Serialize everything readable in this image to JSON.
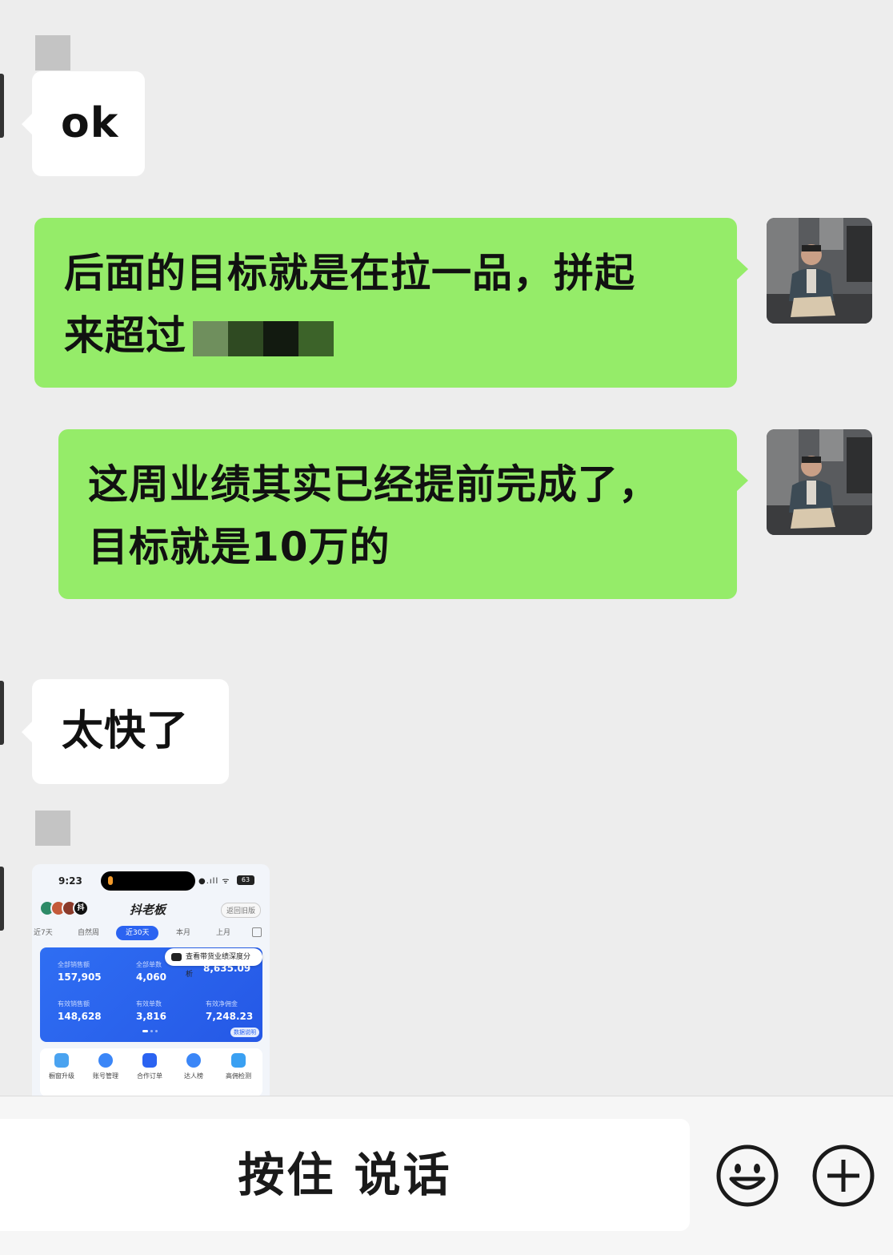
{
  "messages": {
    "m1": {
      "text": "ok"
    },
    "m2": {
      "text_line1": "后面的目标就是在拉一品，拼起",
      "text_line2": "来超过"
    },
    "m3": {
      "text_line1": "这周业绩其实已经提前完成了，",
      "text_line2": "目标就是10万的"
    },
    "m4": {
      "text": "太快了"
    }
  },
  "shared_screenshot": {
    "time": "9:23",
    "signal": "●.ıll ᯤ",
    "battery": "63",
    "logo_badge": "抖",
    "title": "抖老板",
    "old_version": "返回旧版",
    "tabs": [
      "近7天",
      "自然周",
      "近30天",
      "本月",
      "上月"
    ],
    "active_tab": "近30天",
    "tip": "查看带货业绩深度分析",
    "metrics": [
      {
        "label": "全部销售额",
        "value": "157,905"
      },
      {
        "label": "全部单数",
        "value": "4,060"
      },
      {
        "label": "",
        "value": "8,635.09"
      },
      {
        "label": "有效销售额",
        "value": "148,628"
      },
      {
        "label": "有效单数",
        "value": "3,816"
      },
      {
        "label": "有效净佣金",
        "value": "7,248.23"
      }
    ],
    "data_note": "数据说明",
    "actions": [
      "橱窗升级",
      "账号管理",
      "合作订单",
      "达人榜",
      "高佣检测"
    ]
  },
  "input_bar": {
    "voice_label": "按住 说话"
  },
  "colors": {
    "chat_bg": "#ededed",
    "green_bubble": "#95ec69",
    "white_bubble": "#ffffff",
    "accent_blue": "#2b63f1"
  }
}
